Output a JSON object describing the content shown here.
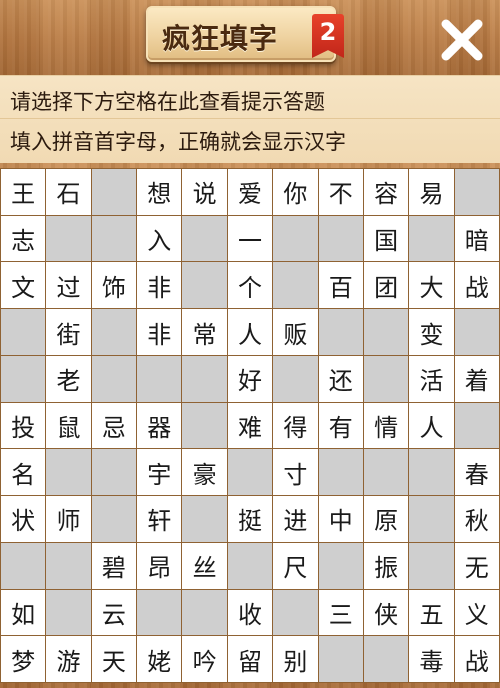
{
  "header": {
    "title": "疯狂填字",
    "level": "2",
    "close_icon": "close-icon"
  },
  "hints": {
    "line1": "请选择下方空格在此查看提示答题",
    "line2": "填入拼音首字母，正确就会显示汉字"
  },
  "colors": {
    "wood": "#b87a43",
    "hint_bg": "#f3dfba",
    "cell_white": "#ffffff",
    "cell_blank": "#cfcfcf",
    "badge": "#d63322"
  },
  "board": {
    "rows": [
      [
        "王",
        "石",
        "#",
        "想",
        "说",
        "爱",
        "你",
        "不",
        "容",
        "易",
        "#"
      ],
      [
        "志",
        "#",
        "#",
        "入",
        "#",
        "一",
        "#",
        "#",
        "国",
        "#",
        "暗"
      ],
      [
        "文",
        "过",
        "饰",
        "非",
        "#",
        "个",
        "#",
        "百",
        "团",
        "大",
        "战"
      ],
      [
        "#",
        "街",
        "#",
        "非",
        "常",
        "人",
        "贩",
        "#",
        "#",
        "变",
        "#"
      ],
      [
        "#",
        "老",
        "#",
        "#",
        "#",
        "好",
        "#",
        "还",
        "#",
        "活",
        "着"
      ],
      [
        "投",
        "鼠",
        "忌",
        "器",
        "#",
        "难",
        "得",
        "有",
        "情",
        "人",
        "#"
      ],
      [
        "名",
        "#",
        "#",
        "宇",
        "豪",
        "#",
        "寸",
        "#",
        "#",
        "#",
        "春"
      ],
      [
        "状",
        "师",
        "#",
        "轩",
        "#",
        "挺",
        "进",
        "中",
        "原",
        "#",
        "秋"
      ],
      [
        "#",
        "#",
        "碧",
        "昂",
        "丝",
        "#",
        "尺",
        "#",
        "振",
        "#",
        "无"
      ],
      [
        "如",
        "#",
        "云",
        "#",
        "#",
        "收",
        "#",
        "三",
        "侠",
        "五",
        "义"
      ],
      [
        "梦",
        "游",
        "天",
        "姥",
        "吟",
        "留",
        "别",
        "#",
        "#",
        "毒",
        "战"
      ]
    ]
  }
}
